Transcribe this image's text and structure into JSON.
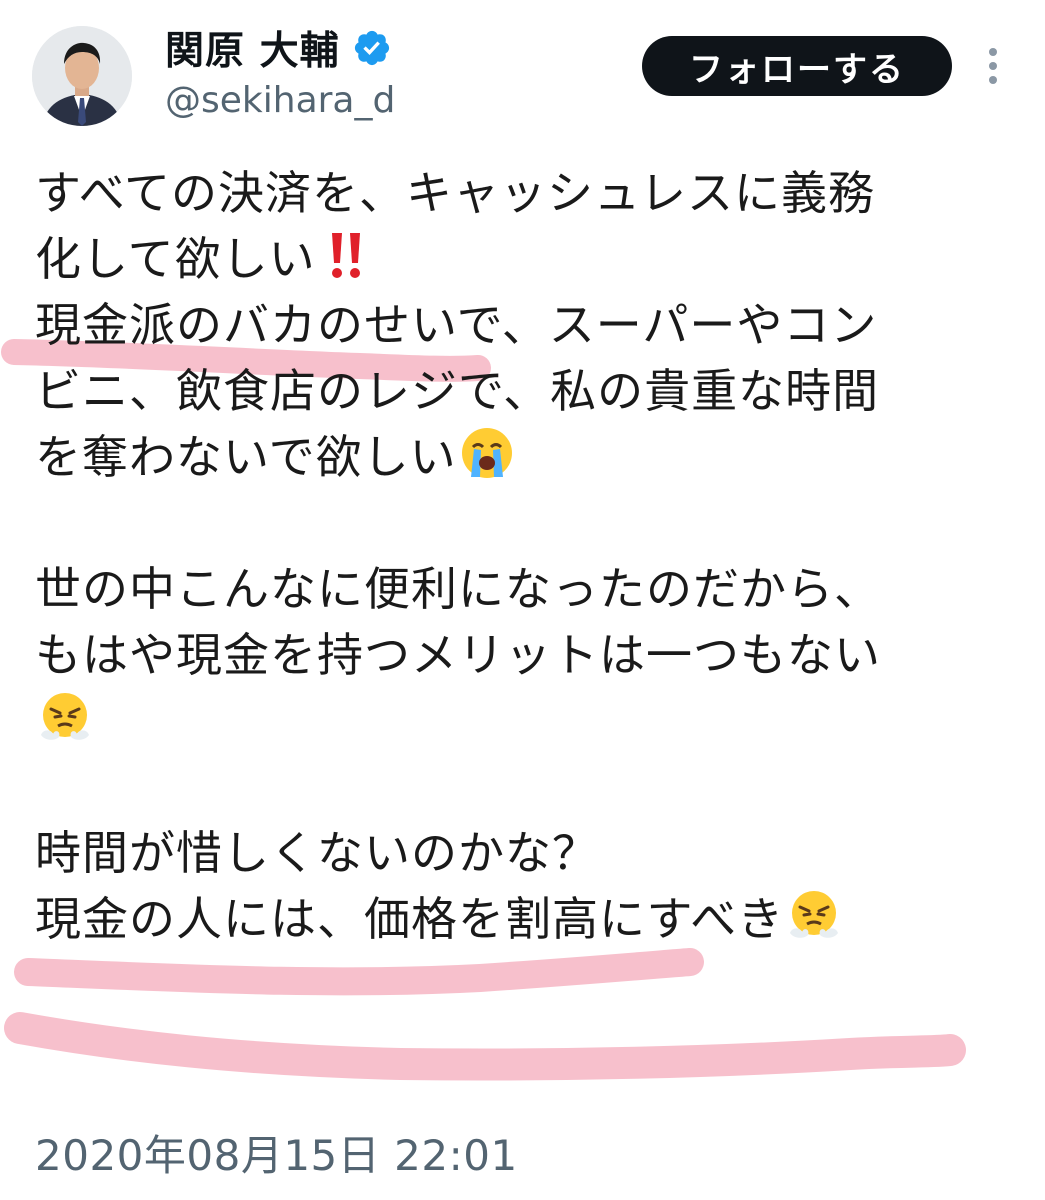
{
  "author": {
    "display_name": "関原 大輔",
    "handle": "@sekihara_d",
    "verified": true,
    "avatar": "person-avatar"
  },
  "actions": {
    "follow_label": "フォローする",
    "more_icon": "more-vertical-icon"
  },
  "tweet": {
    "p1_line1": "すべての決済を、キャッシュレスに義務",
    "p1_line2": "化して欲しい",
    "p1_line2_emoji": "double-exclamation-emoji",
    "p1_line3": "現金派のバカのせいで、スーパーやコン",
    "p1_line4": "ビニ、飲食店のレジで、私の貴重な時間",
    "p1_line5": "を奪わないで欲しい",
    "p1_line5_emoji": "loudly-crying-face-emoji",
    "p2_line1": "世の中こんなに便利になったのだから、",
    "p2_line2": "もはや現金を持つメリットは一つもない",
    "p2_line3_emoji": "face-with-steam-emoji",
    "p3_line1": "時間が惜しくないのかな？",
    "p3_line2": "現金の人には、価格を割高にすべき",
    "p3_line2_emoji": "face-with-steam-emoji"
  },
  "timestamp": "2020年08月15日 22:01",
  "colors": {
    "text": "#0f1419",
    "secondary": "#536471",
    "verified": "#1d9bf0",
    "follow_bg": "#0f1419",
    "highlight": "#f4a7b9"
  }
}
